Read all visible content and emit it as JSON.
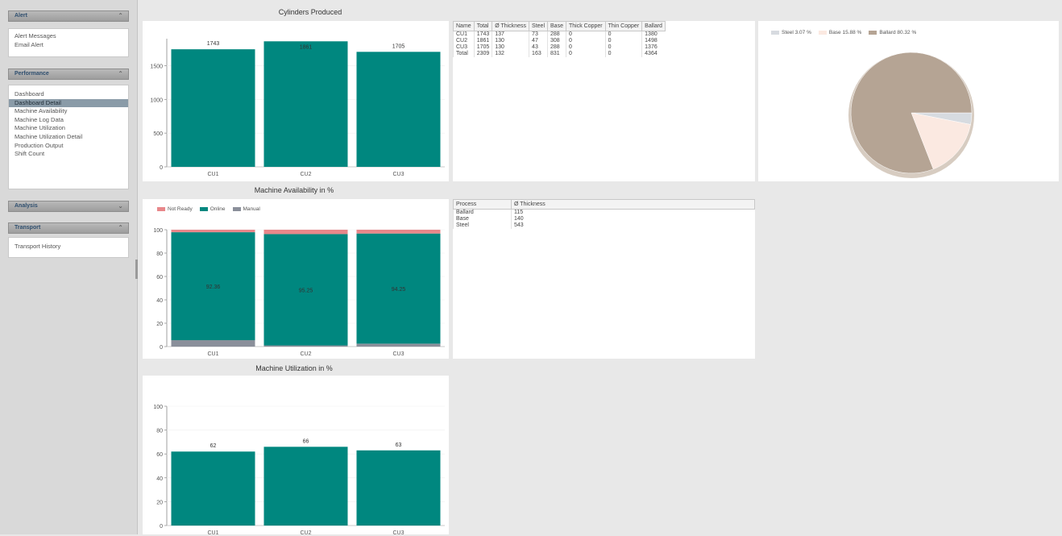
{
  "sidebar": {
    "sections": [
      {
        "title": "Alert",
        "items": [
          "Alert Messages",
          "Email Alert"
        ]
      },
      {
        "title": "Performance",
        "items": [
          "Dashboard",
          "Dashboard Detail",
          "Machine Availability",
          "Machine Log Data",
          "Machine Utilization",
          "Machine Utilization Detail",
          "Production Output",
          "Shift Count"
        ],
        "active": "Dashboard Detail"
      },
      {
        "title": "Analysis",
        "items": []
      },
      {
        "title": "Transport",
        "items": [
          "Transport History"
        ]
      }
    ],
    "chevron": "chevron-up-icon"
  },
  "cylinders_table": {
    "columns": [
      "Name",
      "Total",
      "Ø Thickness",
      "Steel",
      "Base",
      "Thick Copper",
      "Thin Copper",
      "Ballard"
    ],
    "rows": [
      [
        "CU1",
        "1743",
        "137",
        "73",
        "288",
        "0",
        "0",
        "1380"
      ],
      [
        "CU2",
        "1861",
        "130",
        "47",
        "308",
        "0",
        "0",
        "1498"
      ],
      [
        "CU3",
        "1705",
        "130",
        "43",
        "288",
        "0",
        "0",
        "1376"
      ],
      [
        "Total",
        "2309",
        "132",
        "163",
        "831",
        "0",
        "0",
        "4364"
      ]
    ]
  },
  "process_table": {
    "columns": [
      "Process",
      "Ø Thickness"
    ],
    "rows": [
      [
        "Ballard",
        "115"
      ],
      [
        "Base",
        "140"
      ],
      [
        "Steel",
        "543"
      ]
    ]
  },
  "colors": {
    "teal": "#00877f",
    "grey_bar": "#8a8f9a",
    "red": "#e8878a"
  },
  "chart_data": [
    {
      "type": "bar",
      "title": "Cylinders Produced",
      "categories": [
        "CU1",
        "CU2",
        "CU3"
      ],
      "values": [
        1743,
        1861,
        1705
      ],
      "labels": [
        "1743",
        "1861",
        "1705"
      ],
      "yticks": [
        0,
        500,
        1000,
        1500
      ],
      "ylim": [
        0,
        1900
      ],
      "color": "#00877f"
    },
    {
      "type": "bar",
      "stacked": true,
      "title": "Machine Availability in %",
      "categories": [
        "CU1",
        "CU2",
        "CU3"
      ],
      "series": [
        {
          "name": "Manual",
          "values": [
            5.5,
            1.0,
            2.5
          ],
          "color": "#8a8f9a"
        },
        {
          "name": "Online",
          "values": [
            92.36,
            95.25,
            94.25
          ],
          "labels": [
            "92.36",
            "95.25",
            "94.25"
          ],
          "color": "#00877f"
        },
        {
          "name": "Not Ready",
          "values": [
            2.14,
            3.75,
            3.25
          ],
          "color": "#e8878a"
        }
      ],
      "legend_order": [
        "Not Ready",
        "Online",
        "Manual"
      ],
      "yticks": [
        0,
        20,
        40,
        60,
        80,
        100
      ],
      "ylim": [
        0,
        100
      ]
    },
    {
      "type": "bar",
      "title": "Machine Utilization in %",
      "categories": [
        "CU1",
        "CU2",
        "CU3"
      ],
      "values": [
        62,
        66,
        63
      ],
      "labels": [
        "62",
        "66",
        "63"
      ],
      "yticks": [
        0,
        20,
        40,
        60,
        80,
        100
      ],
      "ylim": [
        0,
        100
      ],
      "color": "#00877f"
    },
    {
      "type": "pie",
      "slices": [
        {
          "name": "Steel",
          "legend": "Steel 3.07 %",
          "value": 3.07,
          "color": "#d7dbe0"
        },
        {
          "name": "Base",
          "legend": "Base 15.88 %",
          "value": 15.88,
          "color": "#fbe9e1"
        },
        {
          "name": "Ballard",
          "legend": "Ballard 80.32 %",
          "value": 80.32,
          "color": "#b5a494"
        }
      ]
    }
  ]
}
